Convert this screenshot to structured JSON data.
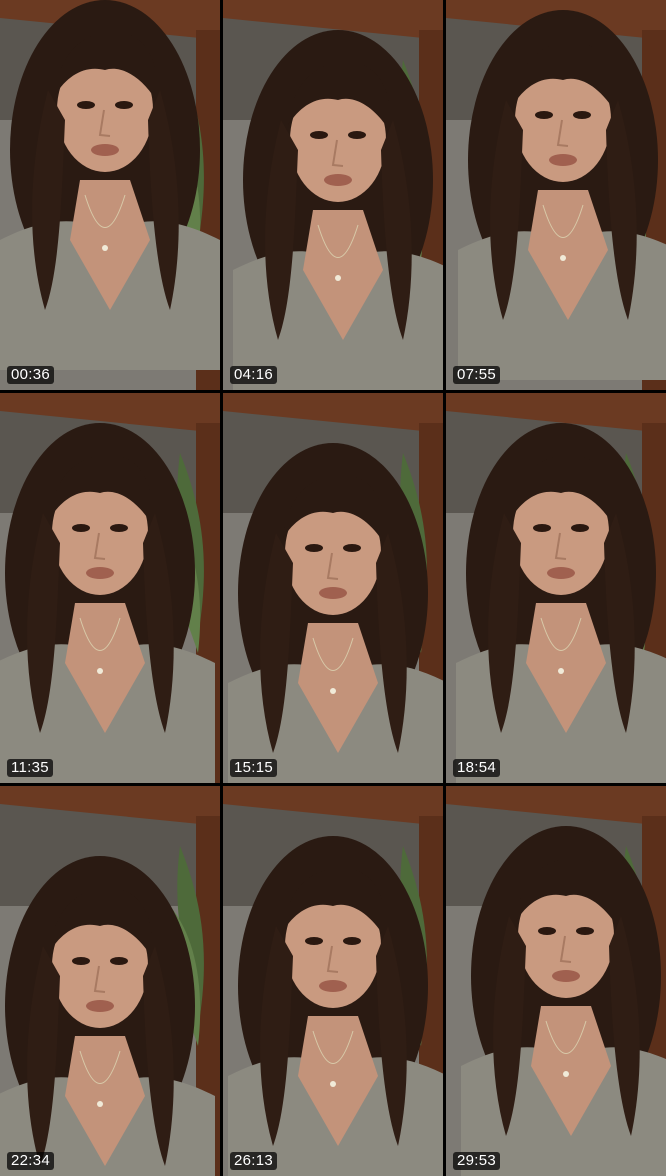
{
  "grid": {
    "frames": [
      {
        "timestamp": "00:36"
      },
      {
        "timestamp": "04:16"
      },
      {
        "timestamp": "07:55"
      },
      {
        "timestamp": "11:35"
      },
      {
        "timestamp": "15:15"
      },
      {
        "timestamp": "18:54"
      },
      {
        "timestamp": "22:34"
      },
      {
        "timestamp": "26:13"
      },
      {
        "timestamp": "29:53"
      }
    ]
  },
  "colors": {
    "background": "#000000",
    "wall": "#8a8680",
    "wood_beam": "#6b3a22",
    "hair": "#2a1a12",
    "skin": "#c99a80",
    "shirt": "#8c8a80",
    "plant": "#4e6a3a",
    "timestamp_bg": "#000000",
    "timestamp_text": "#ffffff"
  }
}
